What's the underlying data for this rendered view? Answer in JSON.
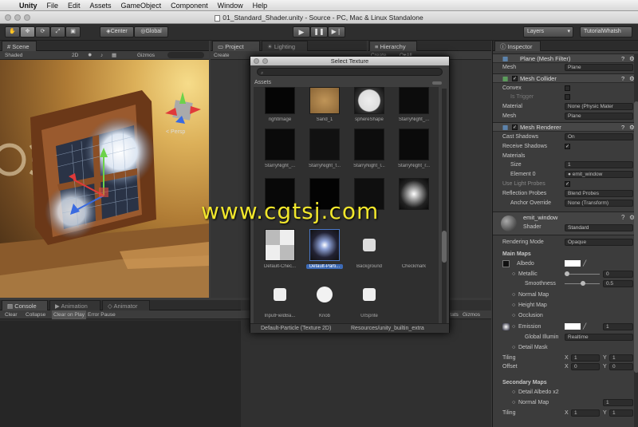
{
  "menubar": {
    "apple": "",
    "app": "Unity",
    "items": [
      "File",
      "Edit",
      "Assets",
      "GameObject",
      "Component",
      "Window",
      "Help"
    ]
  },
  "window": {
    "title": "01_Standard_Shader.unity - Source - PC, Mac & Linux Standalone"
  },
  "toolbar": {
    "pivot": "Center",
    "space": "Global",
    "layers": "Layers",
    "layout": "TutorialWhatsh"
  },
  "scene": {
    "tab": "Scene",
    "shading": "Shaded",
    "mode2d": "2D",
    "gizmos": "Gizmos",
    "persp": "< Persp"
  },
  "project": {
    "tab": "Project",
    "create": "Create"
  },
  "lighting": {
    "tab": "Lighting"
  },
  "hierarchy": {
    "tab": "Hierarchy",
    "create": "Create",
    "search": "Q▾All"
  },
  "picker": {
    "title": "Select Texture",
    "section": "Assets",
    "tiles": [
      {
        "name": "rightImage"
      },
      {
        "name": "Sand_1"
      },
      {
        "name": "sphereShape"
      },
      {
        "name": "StarryNight_..."
      },
      {
        "name": "StarryNight_..."
      },
      {
        "name": "StarryNight_f..."
      },
      {
        "name": "StarryNight_l..."
      },
      {
        "name": "StarryNight_r..."
      },
      {
        "name": ""
      },
      {
        "name": ""
      },
      {
        "name": ""
      },
      {
        "name": ""
      },
      {
        "name": "Default-Chec..."
      },
      {
        "name": "Default-Parti..."
      },
      {
        "name": "Background"
      },
      {
        "name": "Checkmark"
      },
      {
        "name": "InputFieldBa..."
      },
      {
        "name": "Knob"
      },
      {
        "name": "UISprite"
      }
    ],
    "footer_name": "Default-Particle (Texture 2D)",
    "footer_path": "Resources/unity_builtin_extra"
  },
  "console": {
    "tab_console": "Console",
    "tab_animation": "Animation",
    "tab_animator": "Animator",
    "clear": "Clear",
    "collapse": "Collapse",
    "clear_on_play": "Clear on Play",
    "error_pause": "Error Pause",
    "stats": "Stats",
    "gizmos": "Gizmos"
  },
  "inspector": {
    "tab": "Inspector",
    "mesh_filter": {
      "title": "Plane (Mesh Filter)",
      "mesh_label": "Mesh",
      "mesh_value": "Plane"
    },
    "mesh_collider": {
      "title": "Mesh Collider",
      "convex": "Convex",
      "is_trigger": "Is Trigger",
      "material_label": "Material",
      "material_value": "None (Physic Mater",
      "mesh_label": "Mesh",
      "mesh_value": "Plane"
    },
    "mesh_renderer": {
      "title": "Mesh Renderer",
      "cast_shadows": "Cast Shadows",
      "cast_value": "On",
      "receive_shadows": "Receive Shadows",
      "materials": "Materials",
      "size_label": "Size",
      "size_value": "1",
      "element_label": "Element 0",
      "element_value": "emit_window",
      "use_light_probes": "Use Light Probes",
      "reflection_label": "Reflection Probes",
      "reflection_value": "Blend Probes",
      "anchor_label": "Anchor Override",
      "anchor_value": "None (Transform)"
    },
    "material": {
      "name": "emit_window",
      "shader_label": "Shader",
      "shader_value": "Standard",
      "rendering_label": "Rendering Mode",
      "rendering_value": "Opaque",
      "main_maps": "Main Maps",
      "albedo": "Albedo",
      "metallic": "Metallic",
      "metallic_value": "0",
      "smoothness": "Smoothness",
      "smoothness_value": "0.5",
      "normal_map": "Normal Map",
      "height_map": "Height Map",
      "occlusion": "Occlusion",
      "emission": "Emission",
      "emission_value": "1",
      "global_illum": "Global Illumin",
      "global_value": "Realtime",
      "detail_mask": "Detail Mask",
      "tiling": "Tiling",
      "offset": "Offset",
      "x": "X",
      "y": "Y",
      "tiling_x": "1",
      "tiling_y": "1",
      "offset_x": "0",
      "offset_y": "0",
      "secondary": "Secondary Maps",
      "detail_albedo": "Detail Albedo x2",
      "normal_map2": "Normal Map",
      "normal2_value": "1",
      "tiling2": "Tiling",
      "tiling2_x": "1",
      "tiling2_y": "1"
    }
  },
  "watermark": "www.cgtsj.com",
  "colors": {
    "accent": "#3d6ab5",
    "watermark": "#f1e62c"
  }
}
